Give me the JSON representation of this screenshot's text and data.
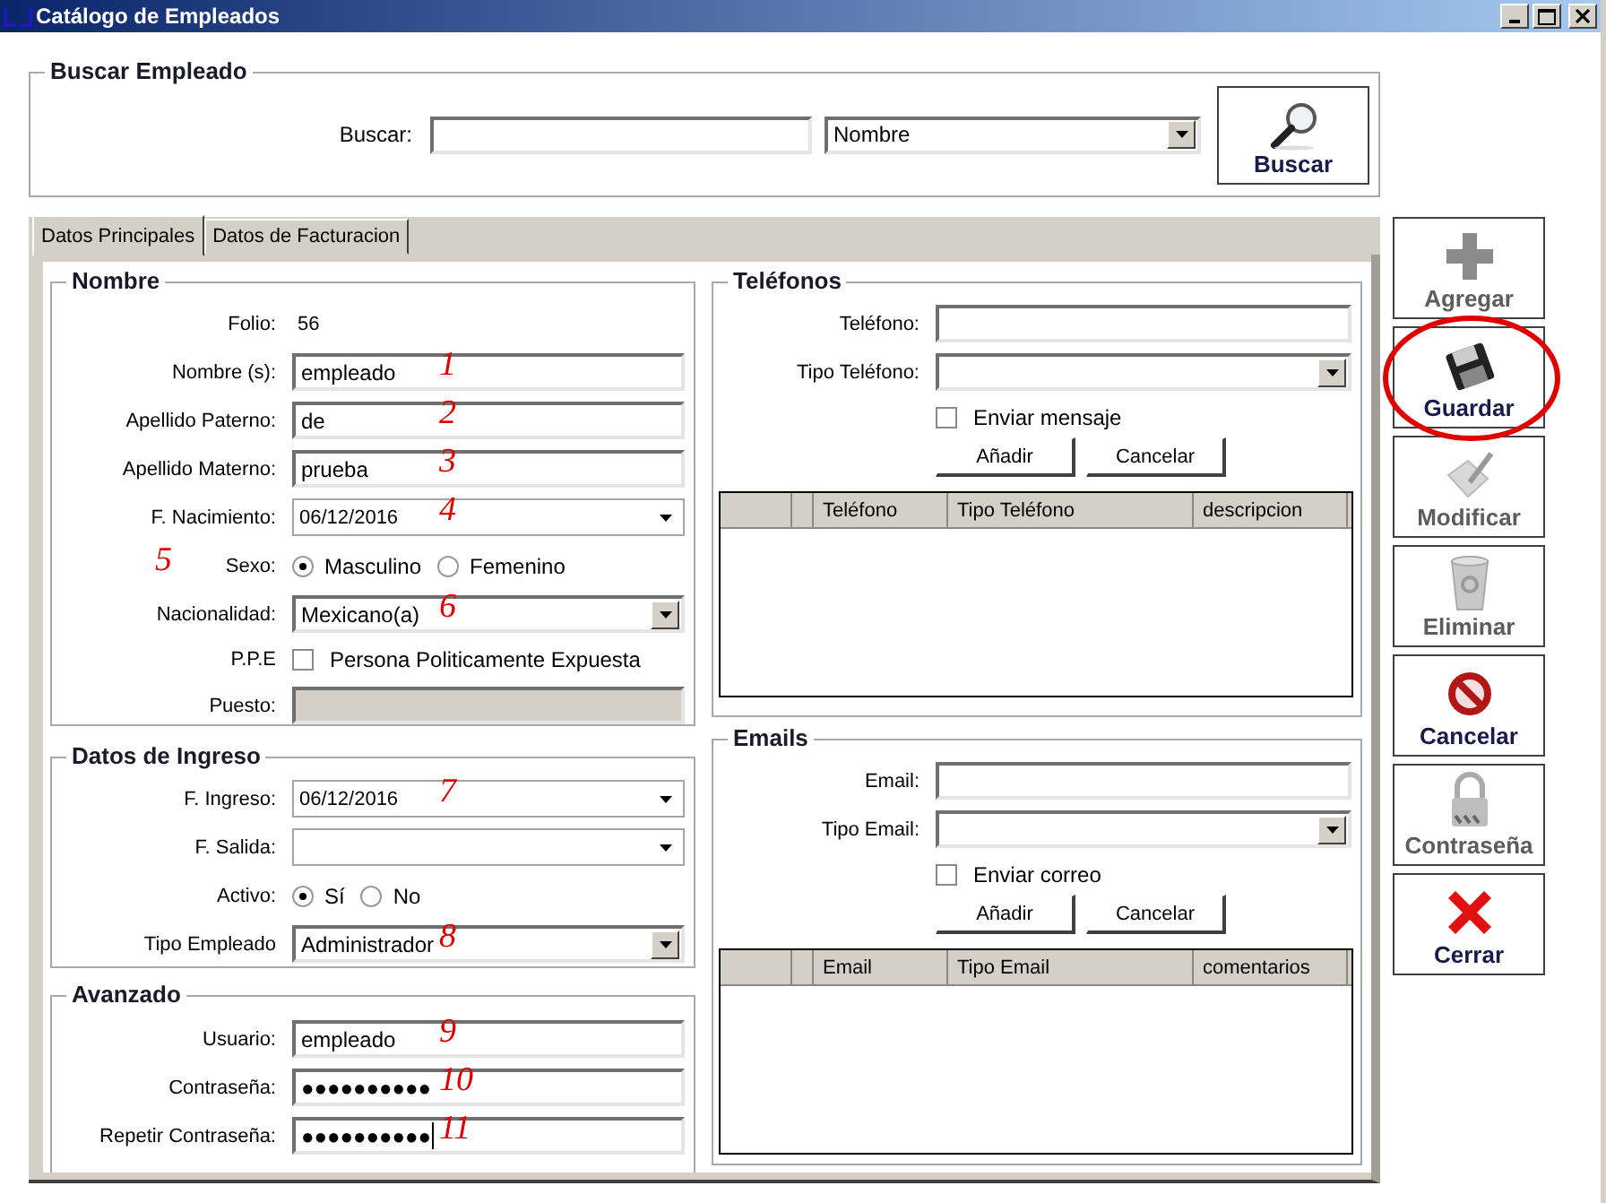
{
  "window": {
    "title": "Catálogo de Empleados"
  },
  "search": {
    "title": "Buscar Empleado",
    "label": "Buscar:",
    "field": "Nombre",
    "button": "Buscar"
  },
  "tabs": [
    {
      "label": "Datos Principales",
      "selected": true
    },
    {
      "label": "Datos de Facturacion",
      "selected": false
    }
  ],
  "nombre": {
    "title": "Nombre",
    "rows": [
      {
        "kind": "static",
        "label": "Folio:",
        "value": "56"
      },
      {
        "kind": "text",
        "label": "Nombre (s):",
        "value": "empleado",
        "note": "1"
      },
      {
        "kind": "text",
        "label": "Apellido Paterno:",
        "value": "de",
        "note": "2"
      },
      {
        "kind": "text",
        "label": "Apellido Materno:",
        "value": "prueba",
        "note": "3"
      },
      {
        "kind": "date",
        "label": "F. Nacimiento:",
        "value": "06/12/2016",
        "note": "4"
      },
      {
        "kind": "radio",
        "label": "Sexo:",
        "note": "5",
        "options": [
          {
            "label": "Masculino",
            "selected": true
          },
          {
            "label": "Femenino",
            "selected": false
          }
        ]
      },
      {
        "kind": "combo",
        "label": "Nacionalidad:",
        "value": "Mexicano(a)",
        "note": "6"
      },
      {
        "kind": "check",
        "label": "P.P.E",
        "text": "Persona Politicamente Expuesta",
        "checked": false
      },
      {
        "kind": "text",
        "label": "Puesto:",
        "disabled": true
      }
    ]
  },
  "ingreso": {
    "title": "Datos de Ingreso",
    "rows": [
      {
        "kind": "date",
        "label": "F. Ingreso:",
        "value": "06/12/2016",
        "note": "7"
      },
      {
        "kind": "date",
        "label": "F. Salida:"
      },
      {
        "kind": "radio",
        "label": "Activo:",
        "options": [
          {
            "label": "Sí",
            "selected": true
          },
          {
            "label": "No",
            "selected": false
          }
        ]
      },
      {
        "kind": "combo",
        "label": "Tipo Empleado",
        "value": "Administrador",
        "note": "8"
      }
    ]
  },
  "avanzado": {
    "title": "Avanzado",
    "rows": [
      {
        "kind": "text",
        "label": "Usuario:",
        "value": "empleado",
        "note": "9"
      },
      {
        "kind": "text",
        "label": "Contraseña:",
        "value": "●●●●●●●●●●",
        "note": "10"
      },
      {
        "kind": "text",
        "label": "Repetir Contraseña:",
        "value": "●●●●●●●●●●",
        "note": "11",
        "focused": true
      }
    ]
  },
  "telefonos": {
    "title": "Teléfonos",
    "rows": [
      {
        "kind": "text",
        "label": "Teléfono:"
      },
      {
        "kind": "combo",
        "label": "Tipo Teléfono:"
      },
      {
        "kind": "check",
        "text": "Enviar mensaje",
        "checked": false
      }
    ],
    "buttons": [
      "Añadir",
      "Cancelar"
    ],
    "columns": [
      "Teléfono",
      "Tipo Teléfono",
      "descripcion"
    ]
  },
  "emails": {
    "title": "Emails",
    "rows": [
      {
        "kind": "text",
        "label": "Email:"
      },
      {
        "kind": "combo",
        "label": "Tipo Email:"
      },
      {
        "kind": "check",
        "text": "Enviar correo",
        "checked": false
      }
    ],
    "buttons": [
      "Añadir",
      "Cancelar"
    ],
    "columns": [
      "Email",
      "Tipo Email",
      "comentarios"
    ]
  },
  "actions": [
    {
      "label": "Agregar",
      "disabled": true,
      "circled": false
    },
    {
      "label": "Guardar",
      "disabled": false,
      "circled": true
    },
    {
      "label": "Modificar",
      "disabled": true,
      "circled": false
    },
    {
      "label": "Eliminar",
      "disabled": true,
      "circled": false
    },
    {
      "label": "Cancelar",
      "disabled": false,
      "circled": false
    },
    {
      "label": "Contraseña",
      "disabled": true,
      "circled": false
    },
    {
      "label": "Cerrar",
      "disabled": false,
      "circled": false
    }
  ]
}
